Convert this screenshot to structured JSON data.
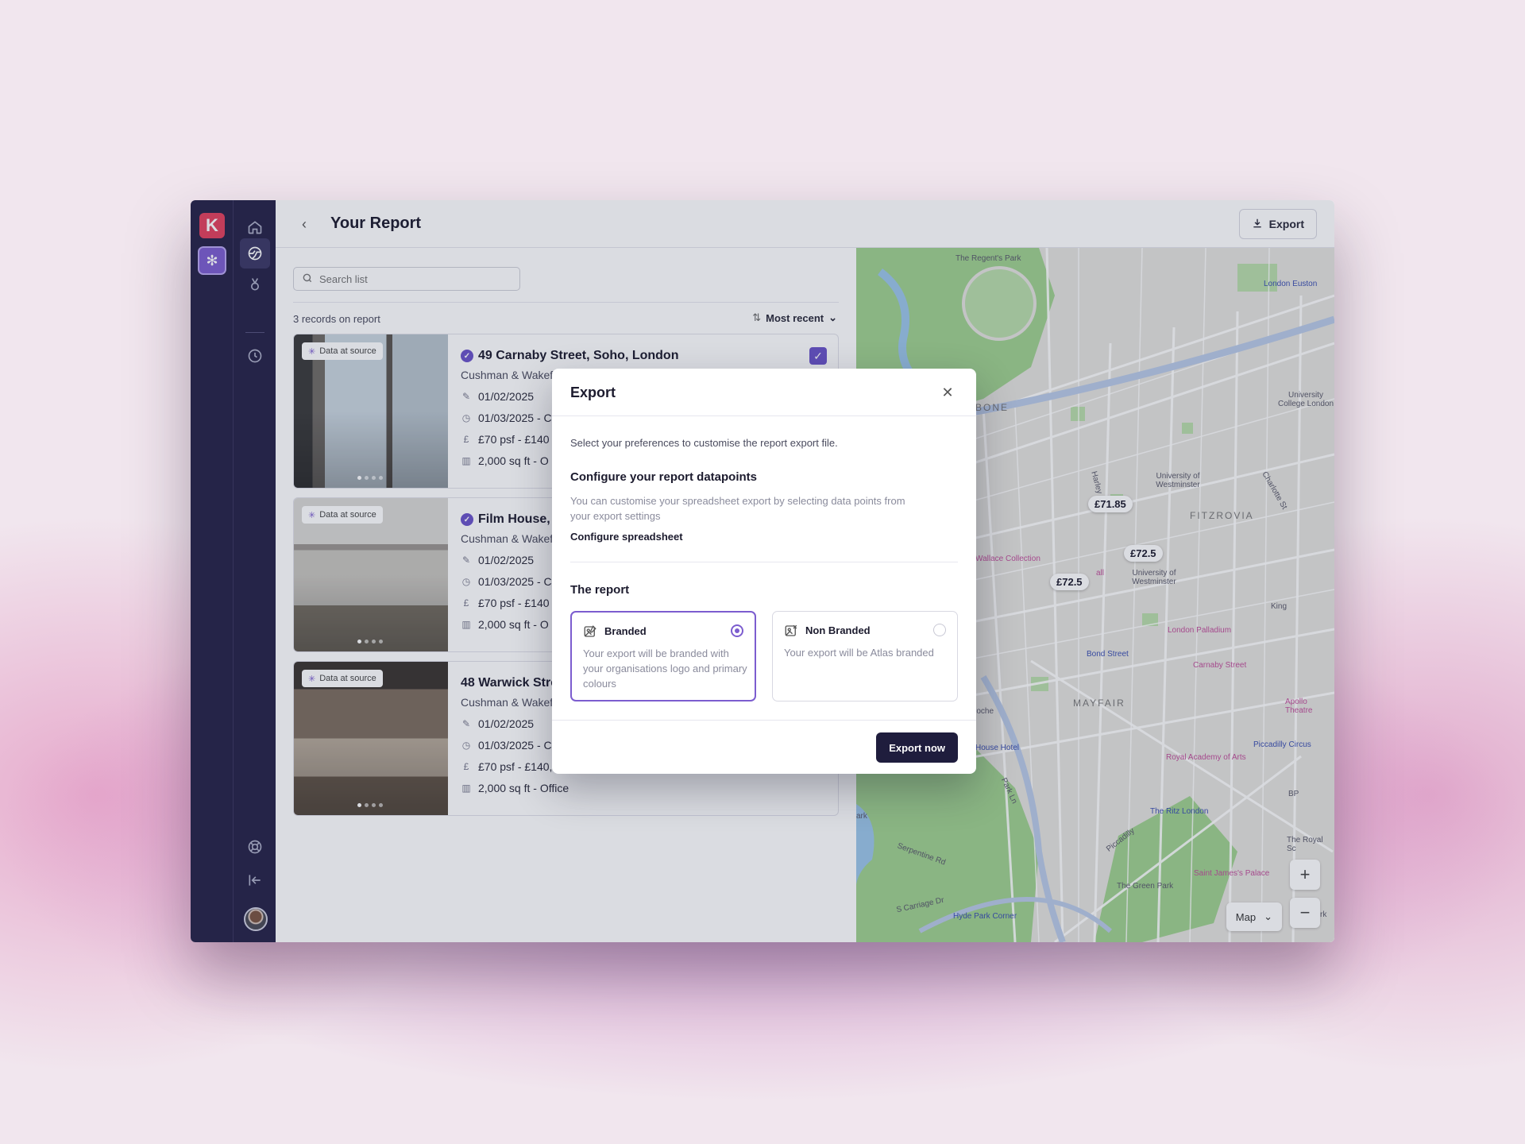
{
  "header": {
    "title": "Your Report",
    "export_label": "Export"
  },
  "search": {
    "placeholder": "Search list"
  },
  "list": {
    "count_text": "3 records on report",
    "sort_label": "Most recent",
    "badge_text": "Data at source",
    "records": [
      {
        "address": "49 Carnaby Street, Soho, London",
        "agent": "Cushman & Wakef",
        "date1": "01/02/2025",
        "date2": "01/03/2025 - C",
        "rent": "£70 psf - £140",
        "size": "2,000 sq ft - O",
        "checked": true
      },
      {
        "address": "Film House, 1",
        "agent": "Cushman & Wakef",
        "date1": "01/02/2025",
        "date2": "01/03/2025 - C",
        "rent": "£70 psf - £140",
        "size": "2,000 sq ft - O",
        "checked": false
      },
      {
        "address": "48 Warwick Stre",
        "agent": "Cushman & Wakef",
        "date1": "01/02/2025",
        "date2": "01/03/2025 - C",
        "rent": "£70 psf - £140,000 pa",
        "size": "2,000 sq ft - Office",
        "checked": false
      }
    ]
  },
  "map": {
    "prices": [
      "£71.85",
      "£72.5",
      "£72.5"
    ],
    "areas": [
      "BONE",
      "FITZROVIA",
      "MAYFAIR"
    ],
    "places": [
      "The Regent's Park",
      "London Euston",
      "University College London",
      "University of Westminster",
      "University of Westminster",
      "Wallace Collection",
      "London Palladium",
      "Carnaby Street",
      "Bond Street",
      "Apollo Theatre",
      "House Hotel",
      "Royal Academy of Arts",
      "Piccadilly Circus",
      "The Ritz London",
      "The Green Park",
      "Saint James's Palace",
      "Hyde Park Corner",
      "Serpentine Rd",
      "S Carriage Dr",
      "Park Ln",
      "Piccadilly",
      "Harley",
      "Charlotte St",
      "King",
      "BP",
      "The Royal Sc",
      "roche",
      "ark",
      "all",
      "Ja",
      "rk"
    ],
    "map_type": "Map",
    "zoom_in": "+",
    "zoom_out": "−"
  },
  "modal": {
    "title": "Export",
    "intro": "Select your preferences to customise the report export file.",
    "config_heading": "Configure your report datapoints",
    "config_desc": "You can customise your spreadsheet export by selecting data points from your export settings",
    "config_link": "Configure spreadsheet",
    "report_heading": "The report",
    "options": [
      {
        "label": "Branded",
        "desc": "Your export will be branded with your organisations logo and primary colours",
        "selected": true
      },
      {
        "label": "Non Branded",
        "desc": "Your export will be Atlas branded",
        "selected": false
      }
    ],
    "submit": "Export now"
  },
  "colors": {
    "accent": "#7c5dcf",
    "sidebar": "#262248",
    "logo": "#e2405d",
    "primary_button": "#1f1d3d"
  }
}
